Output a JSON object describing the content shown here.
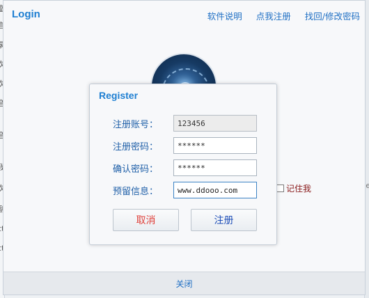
{
  "background_window": {
    "left_fragments": [
      "室",
      "言",
      "录",
      "次",
      "次",
      "音",
      "音",
      "我",
      "次",
      "副",
      "ct",
      "ct"
    ],
    "right_fragments": [
      "e"
    ]
  },
  "login": {
    "title": "Login",
    "links": [
      "软件说明",
      "点我注册",
      "找回/修改密码"
    ],
    "remember_label": "记住我",
    "remember_checked": false,
    "close_label": "关闭"
  },
  "register": {
    "title": "Register",
    "fields": [
      {
        "label": "注册账号：",
        "value": "123456",
        "placeholder": ""
      },
      {
        "label": "注册密码：",
        "value": "******",
        "placeholder": ""
      },
      {
        "label": "确认密码：",
        "value": "******",
        "placeholder": ""
      },
      {
        "label": "预留信息：",
        "value": "www.ddooo.com",
        "placeholder": ""
      }
    ],
    "cancel_label": "取消",
    "submit_label": "注册"
  },
  "colors": {
    "accent": "#1e7fd2",
    "label": "#1f5fa8",
    "cancel": "#e0423c",
    "submit": "#1f4fb8",
    "remember": "#8a1c1c"
  }
}
